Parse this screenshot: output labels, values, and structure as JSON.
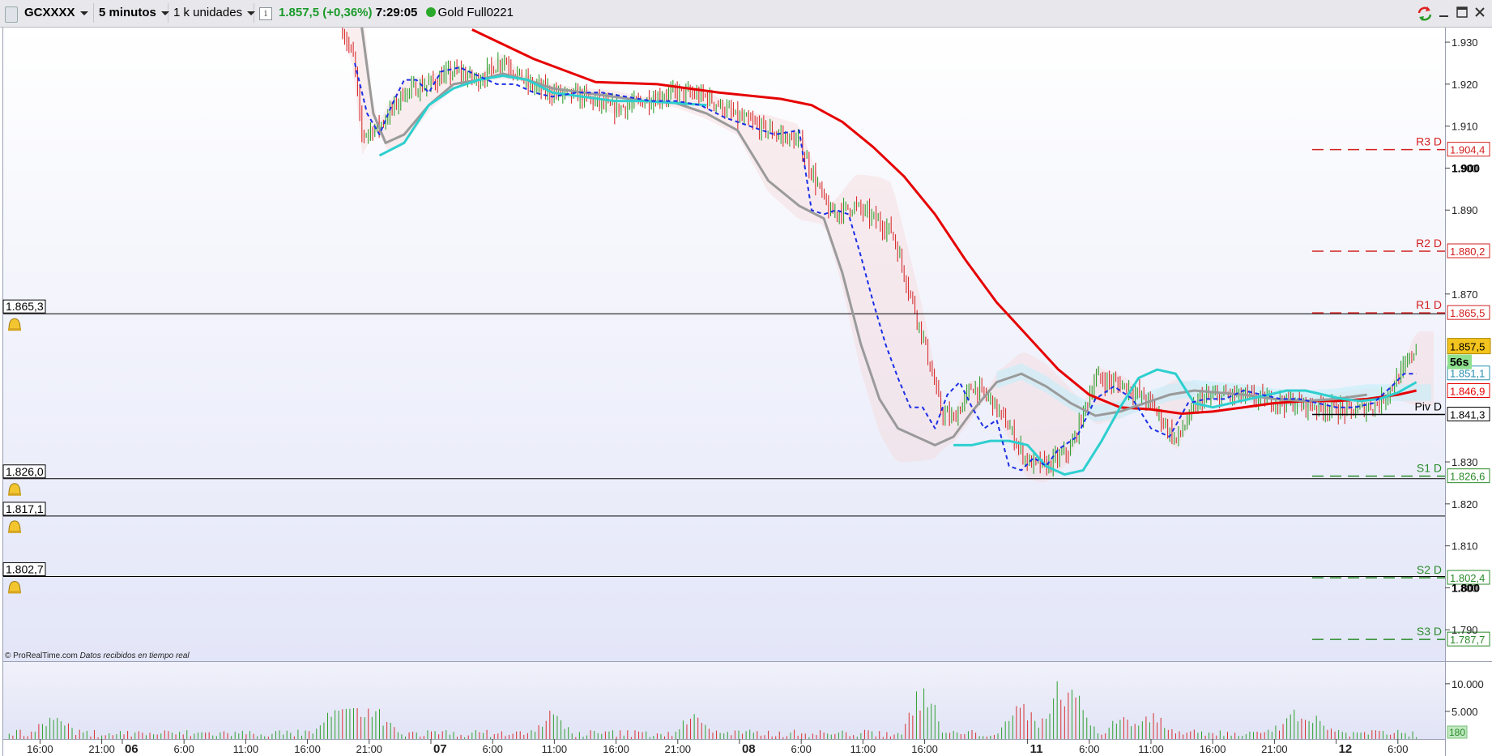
{
  "toolbar": {
    "instrument": "GCXXXX",
    "timeframe": "5 minutos",
    "units": "1 k unidades",
    "info_glyph": "i",
    "last_price": "1.857,5",
    "change": "(+0,36%)",
    "time": "7:29:05",
    "description": "Gold Full0221",
    "icons": [
      "drag-grip-icon",
      "caret-down-icon",
      "info-icon",
      "realtime-status-icon",
      "sync-icon",
      "minimize-icon",
      "maximize-icon",
      "close-icon"
    ]
  },
  "colors": {
    "background_top": "#ffffff",
    "background_bottom": "#e3e6f8",
    "ma_slow": "#e60000",
    "ma_mid": "#9a9a9a",
    "ma_fast": "#2ecfcf",
    "tenkan": "#1a2ee6",
    "candle_up": "#2fa02f",
    "candle_down": "#d83030",
    "resistance": "#d42020",
    "support": "#2a8a2a",
    "pivot": "#000000"
  },
  "chart_data": {
    "type": "line",
    "instrument": "GCXXXX",
    "interval": "5 minutos",
    "y_range": [
      1783,
      1936
    ],
    "y_ticks": [
      "1.930",
      "1.920",
      "1.910",
      "1.900",
      "1.890",
      "1.870",
      "1.830",
      "1.820",
      "1.810",
      "1.800",
      "1.790"
    ],
    "x_ticks": [
      {
        "label": "16:00",
        "t": -0.5
      },
      {
        "label": "21:00",
        "t": 0.5
      },
      {
        "label": "06",
        "t": 0.833,
        "bold": true
      },
      {
        "label": "6:00",
        "t": 1.833
      },
      {
        "label": "11:00",
        "t": 2.833
      },
      {
        "label": "16:00",
        "t": 3.833
      },
      {
        "label": "21:00",
        "t": 4.833
      },
      {
        "label": "07",
        "t": 5.833,
        "bold": true
      },
      {
        "label": "6:00",
        "t": 6.833
      },
      {
        "label": "11:00",
        "t": 7.833
      },
      {
        "label": "16:00",
        "t": 8.833
      },
      {
        "label": "21:00",
        "t": 9.833
      },
      {
        "label": "08",
        "t": 10.833,
        "bold": true
      },
      {
        "label": "6:00",
        "t": 11.833
      },
      {
        "label": "11:00",
        "t": 12.833
      },
      {
        "label": "16:00",
        "t": 13.833
      },
      {
        "label": "11",
        "t": 15.5,
        "bold": true
      },
      {
        "label": "6:00",
        "t": 16.5
      },
      {
        "label": "11:00",
        "t": 17.5
      },
      {
        "label": "16:00",
        "t": 18.5
      },
      {
        "label": "21:00",
        "t": 19.5
      },
      {
        "label": "12",
        "t": 20.5,
        "bold": true
      },
      {
        "label": "6:00",
        "t": 21.5
      }
    ],
    "price": {
      "t": [
        4.4,
        4.6,
        4.7,
        5.0,
        5.4,
        5.8,
        6.2,
        6.6,
        7.0,
        7.4,
        7.8,
        8.3,
        8.8,
        9.3,
        9.8,
        10.3,
        10.8,
        11.3,
        11.8,
        12.3,
        12.7,
        13.3,
        13.8,
        14.1,
        14.3,
        14.6,
        14.9,
        15.2,
        15.5,
        15.8,
        16.2,
        16.6,
        17.1,
        17.5,
        17.9,
        18.3,
        18.8,
        19.3,
        19.8,
        20.3,
        20.8,
        21.2,
        21.6,
        21.8
      ],
      "v": [
        1933,
        1925,
        1908,
        1910,
        1918,
        1920,
        1923,
        1921,
        1926,
        1920,
        1918,
        1917,
        1914,
        1916,
        1918,
        1917,
        1912,
        1909,
        1906,
        1889,
        1891,
        1885,
        1860,
        1842,
        1840,
        1848,
        1845,
        1838,
        1830,
        1829,
        1833,
        1850,
        1848,
        1844,
        1835,
        1845,
        1846,
        1845,
        1844,
        1843,
        1842,
        1844,
        1852,
        1857.5
      ]
    },
    "series": [
      {
        "name": "",
        "role": "ma-slow",
        "t": [
          6.5,
          7.5,
          8.5,
          9.5,
          10.5,
          11.5,
          12.0,
          12.5,
          13.0,
          13.5,
          14.0,
          14.5,
          15.0,
          15.5,
          16.0,
          16.5,
          17.0,
          17.5,
          18.0,
          18.5,
          19.0,
          19.5,
          20.0,
          20.5,
          21.0,
          21.5,
          21.8
        ],
        "v": [
          1933,
          1926,
          1920.5,
          1920,
          1918,
          1916.5,
          1915,
          1911,
          1905,
          1898,
          1889,
          1878,
          1868,
          1860,
          1852,
          1846,
          1843,
          1842.5,
          1841.5,
          1842,
          1843,
          1844,
          1844.5,
          1844.5,
          1845,
          1846,
          1847
        ]
      },
      {
        "name": "",
        "role": "ma-mid",
        "t": [
          4.7,
          4.9,
          5.1,
          5.4,
          5.8,
          6.2,
          6.6,
          7.0,
          7.4,
          7.8,
          8.3,
          8.8,
          9.3,
          9.8,
          10.3,
          10.8,
          11.3,
          11.8,
          12.2,
          12.5,
          12.8,
          13.1,
          13.4,
          13.7,
          14.0,
          14.3,
          14.6,
          15.0,
          15.4,
          15.8,
          16.2,
          16.6,
          17.0,
          17.4,
          17.8,
          18.2,
          18.6,
          19.0,
          19.5,
          20.0,
          20.5,
          21.0
        ],
        "v": [
          1935,
          1913,
          1906,
          1908,
          1915,
          1920,
          1921,
          1922.5,
          1921,
          1919,
          1918,
          1917,
          1916,
          1915.5,
          1913,
          1909,
          1897,
          1891,
          1888,
          1875,
          1858,
          1845,
          1838,
          1836,
          1834,
          1836,
          1842,
          1849,
          1851,
          1848,
          1844,
          1841,
          1842,
          1844,
          1846,
          1847,
          1846.5,
          1846,
          1845,
          1844.5,
          1845,
          1846
        ]
      },
      {
        "name": "",
        "role": "ma-fast",
        "t": [
          5.0,
          5.4,
          5.8,
          6.2,
          6.6,
          7.0,
          7.4,
          7.8,
          8.3,
          8.8,
          9.3,
          9.8,
          10.3,
          14.3,
          14.6,
          14.9,
          15.2,
          15.5,
          15.8,
          16.1,
          16.4,
          16.7,
          17.0,
          17.3,
          17.6,
          17.9,
          18.2,
          18.5,
          18.8,
          19.1,
          19.4,
          19.7,
          20.0,
          20.3,
          20.6,
          20.9,
          21.2,
          21.5,
          21.8
        ],
        "v": [
          1903,
          1906,
          1915,
          1919,
          1921,
          1922,
          1921,
          1918,
          1917,
          1916,
          1916,
          1915.5,
          1915,
          1834,
          1834,
          1835,
          1835,
          1834,
          1829,
          1827,
          1828,
          1835,
          1843,
          1850,
          1852,
          1851,
          1844,
          1843,
          1844,
          1845,
          1846,
          1847,
          1847,
          1846,
          1845,
          1844.5,
          1845,
          1846.5,
          1849
        ]
      },
      {
        "name": "",
        "role": "tenkan",
        "t": [
          4.6,
          4.8,
          5.0,
          5.2,
          5.4,
          5.6,
          5.8,
          6.0,
          6.3,
          6.6,
          6.9,
          7.2,
          7.5,
          7.8,
          8.2,
          8.6,
          9.0,
          9.4,
          9.8,
          10.2,
          10.6,
          11.0,
          11.4,
          11.8,
          12.0,
          12.2,
          12.4,
          12.6,
          12.8,
          13.0,
          13.2,
          13.4,
          13.6,
          13.8,
          14.0,
          14.2,
          14.4,
          14.6,
          14.8,
          15.0,
          15.2,
          15.4,
          15.6,
          15.8,
          16.0,
          16.3,
          16.6,
          16.9,
          17.2,
          17.5,
          17.8,
          18.1,
          18.4,
          18.7,
          19.0,
          19.3,
          19.6,
          19.9,
          20.2,
          20.5,
          20.8,
          21.1,
          21.4,
          21.6,
          21.8
        ],
        "v": [
          1925,
          1913,
          1908,
          1915,
          1921,
          1921,
          1918,
          1923,
          1924,
          1922,
          1920,
          1920,
          1918,
          1917,
          1918,
          1918,
          1917,
          1916,
          1916,
          1915,
          1912,
          1910,
          1908,
          1909,
          1890,
          1889,
          1890,
          1889,
          1879,
          1868,
          1858,
          1850,
          1843,
          1843,
          1838,
          1846,
          1849,
          1843,
          1838,
          1840,
          1829,
          1828,
          1831,
          1829,
          1833,
          1836,
          1845,
          1848,
          1845,
          1838,
          1836,
          1844,
          1845,
          1845,
          1847,
          1846,
          1845,
          1845,
          1844,
          1843,
          1843,
          1844,
          1848,
          1851,
          1851
        ]
      }
    ],
    "levels": [
      {
        "label": "R3 D",
        "value": 1904.4,
        "text": "1.904,4",
        "kind": "resistance"
      },
      {
        "label": "R2 D",
        "value": 1880.2,
        "text": "1.880,2",
        "kind": "resistance"
      },
      {
        "label": "R1 D",
        "value": 1865.5,
        "text": "1.865,5",
        "kind": "resistance"
      },
      {
        "label": "Piv D",
        "value": 1841.3,
        "text": "1.841,3",
        "kind": "pivot"
      },
      {
        "label": "S1 D",
        "value": 1826.6,
        "text": "1.826,6",
        "kind": "support"
      },
      {
        "label": "S2 D",
        "value": 1802.4,
        "text": "1.802,4",
        "kind": "support"
      },
      {
        "label": "S3 D",
        "value": 1787.7,
        "text": "1.787,7",
        "kind": "support"
      }
    ],
    "alerts": [
      {
        "value": 1865.3,
        "text": "1.865,3"
      },
      {
        "value": 1826.0,
        "text": "1.826,0"
      },
      {
        "value": 1817.1,
        "text": "1.817,1"
      },
      {
        "value": 1802.7,
        "text": "1.802,7"
      }
    ],
    "bold_ticks": [
      {
        "value": 1900,
        "text": "1.900"
      },
      {
        "value": 1800,
        "text": "1.800"
      }
    ],
    "current_price": {
      "value": 1857.5,
      "text": "1.857,5"
    },
    "countdown": "56s",
    "right_labels": [
      {
        "value": 1851.1,
        "text": "1.851,1"
      },
      {
        "value": 1846.9,
        "text": "1.846,9"
      }
    ],
    "volume": {
      "y_ticks": [
        "10.000",
        "5.000"
      ],
      "y_max": 13500,
      "last_volume": "180"
    },
    "attribution": "© ProRealTime.com",
    "attribution_note": "Datos recibidos en tiempo real"
  }
}
